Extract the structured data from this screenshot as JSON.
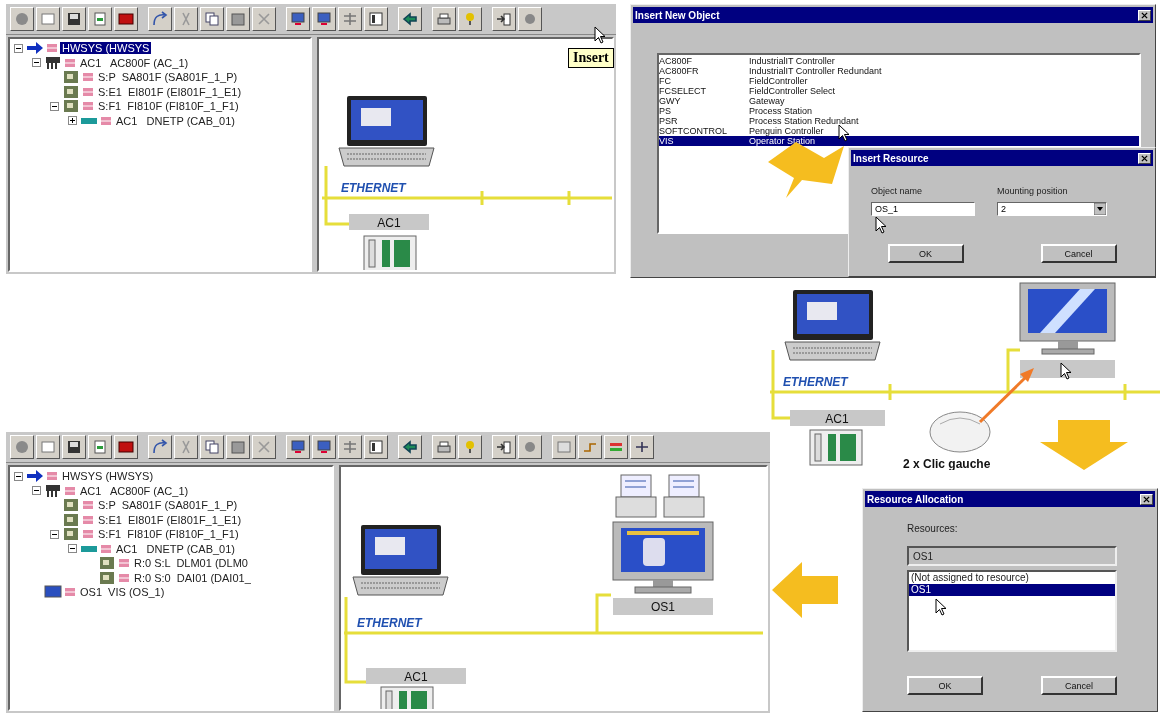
{
  "top_window": {
    "toolbar_tooltip": "Insert",
    "tree": [
      {
        "label": "HWSYS (HWSYS",
        "kind": "system",
        "selected": true,
        "expanded": true,
        "children": [
          {
            "label": "AC1   AC800F (AC_1)",
            "kind": "controller",
            "selected": false,
            "expanded": true,
            "children": [
              {
                "label": "S:P  SA801F (SA801F_1_P)",
                "kind": "module",
                "selected": false
              },
              {
                "label": "S:E1  EI801F (EI801F_1_E1)",
                "kind": "module",
                "selected": false
              },
              {
                "label": "S:F1  FI810F (FI810F_1_F1)",
                "kind": "module",
                "selected": false,
                "expanded": true,
                "children": [
                  {
                    "label": "AC1   DNETP (CAB_01)",
                    "kind": "cabinet",
                    "selected": false,
                    "expanded": false
                  }
                ]
              }
            ]
          }
        ]
      }
    ],
    "diagram": {
      "network_label": "ETHERNET",
      "controller_label": "AC1"
    }
  },
  "insert_new_object_dialog": {
    "title": "Insert New Object",
    "items": [
      {
        "code": "AC800F",
        "description": "IndustrialIT Controller",
        "selected": false
      },
      {
        "code": "AC800FR",
        "description": "IndustrialIT Controller Redundant",
        "selected": false
      },
      {
        "code": "FC",
        "description": "FieldController",
        "selected": false
      },
      {
        "code": "FCSELECT",
        "description": "FieldController Select",
        "selected": false
      },
      {
        "code": "GWY",
        "description": "Gateway",
        "selected": false
      },
      {
        "code": "PS",
        "description": "Process Station",
        "selected": false
      },
      {
        "code": "PSR",
        "description": "Process Station Redundant",
        "selected": false
      },
      {
        "code": "SOFTCONTROL",
        "description": "Penguin Controller",
        "selected": false
      },
      {
        "code": "VIS",
        "description": "Operator Station",
        "selected": true
      }
    ]
  },
  "insert_resource_dialog": {
    "title": "Insert Resource",
    "object_name_label": "Object name",
    "object_name_value": "OS_1",
    "mounting_position_label": "Mounting position",
    "mounting_position_value": "2",
    "buttons": [
      "OK",
      "Cancel"
    ]
  },
  "middle_diagram": {
    "network_label": "ETHERNET",
    "controller_label": "AC1",
    "mouse_caption": "2 x Clic gauche"
  },
  "bottom_window": {
    "tree": [
      {
        "label": "HWSYS (HWSYS)",
        "kind": "system",
        "selected": false,
        "expanded": true,
        "children": [
          {
            "label": "AC1   AC800F (AC_1)",
            "kind": "controller",
            "selected": false,
            "expanded": true,
            "children": [
              {
                "label": "S:P  SA801F (SA801F_1_P)",
                "kind": "module",
                "selected": false
              },
              {
                "label": "S:E1  EI801F (EI801F_1_E1)",
                "kind": "module",
                "selected": false
              },
              {
                "label": "S:F1  FI810F (FI810F_1_F1)",
                "kind": "module",
                "selected": false,
                "expanded": true,
                "children": [
                  {
                    "label": "AC1   DNETP (CAB_01)",
                    "kind": "cabinet",
                    "selected": false,
                    "expanded": true,
                    "children": [
                      {
                        "label": "R:0 S:L  DLM01 (DLM0",
                        "kind": "module",
                        "selected": false
                      },
                      {
                        "label": "R:0 S:0  DAI01 (DAI01_",
                        "kind": "module",
                        "selected": false
                      }
                    ]
                  }
                ]
              }
            ]
          },
          {
            "label": "OS1  VIS (OS_1)",
            "kind": "station",
            "selected": false
          }
        ]
      }
    ],
    "diagram": {
      "network_label": "ETHERNET",
      "controller_label": "AC1",
      "station_label": "OS1"
    }
  },
  "resource_allocation_dialog": {
    "title": "Resource Allocation",
    "resources_label": "Resources:",
    "current_value": "OS1",
    "options": [
      {
        "label": "(Not assigned to resource)",
        "selected": false
      },
      {
        "label": "OS1",
        "selected": true
      }
    ],
    "buttons": [
      "OK",
      "Cancel"
    ]
  }
}
